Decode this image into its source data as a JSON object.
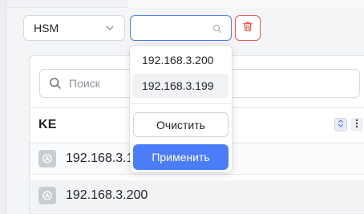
{
  "toolbar": {
    "type_select": {
      "value": "HSM"
    },
    "filter_input": {
      "value": "",
      "placeholder": ""
    }
  },
  "dropdown": {
    "options": [
      "192.168.3.200",
      "192.168.3.199"
    ],
    "clear_label": "Очистить",
    "apply_label": "Применить"
  },
  "panel": {
    "search": {
      "placeholder": "Поиск"
    },
    "column_title": "KE",
    "rows": [
      {
        "ip": "192.168.3.1"
      },
      {
        "ip": "192.168.3.200"
      }
    ]
  },
  "colors": {
    "accent": "#4a7df7",
    "danger": "#e35a4f"
  },
  "icons": {
    "select_chevron": "chevron-down-icon",
    "filter_search": "search-icon",
    "delete": "trash-icon",
    "panel_search": "search-icon",
    "sort": "sort-icon",
    "more": "more-vertical-icon",
    "row_avatar": "device-icon"
  }
}
